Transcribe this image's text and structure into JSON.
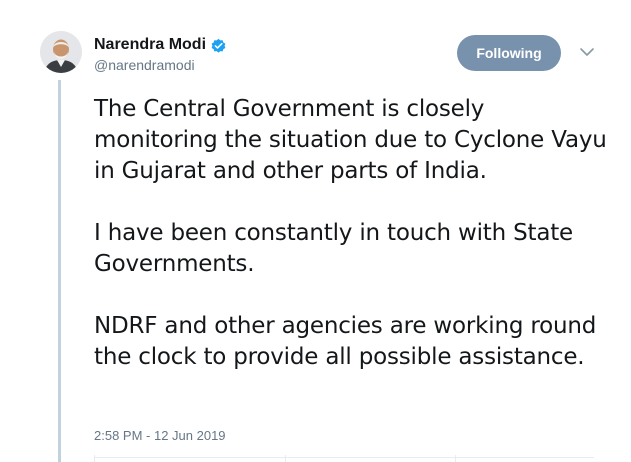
{
  "author": {
    "display_name": "Narendra Modi",
    "handle": "@narendramodi",
    "verified": true,
    "avatar_icon": "profile-photo"
  },
  "follow_button": {
    "label": "Following"
  },
  "menu_icon": "chevron-down-icon",
  "tweet": {
    "paragraphs": [
      "The Central Government is closely monitoring the situation due to Cyclone Vayu in Gujarat and other parts of India.",
      "I have been constantly in touch with State Governments.",
      "NDRF and other agencies are working round the clock to provide all possible assistance."
    ],
    "timestamp": "2:58 PM - 12 Jun 2019"
  },
  "colors": {
    "verified_badge": "#1da1f2",
    "following_button": "#7892ae",
    "thread_line": "#c2d1de",
    "secondary_text": "#657786",
    "primary_text": "#14171a"
  }
}
